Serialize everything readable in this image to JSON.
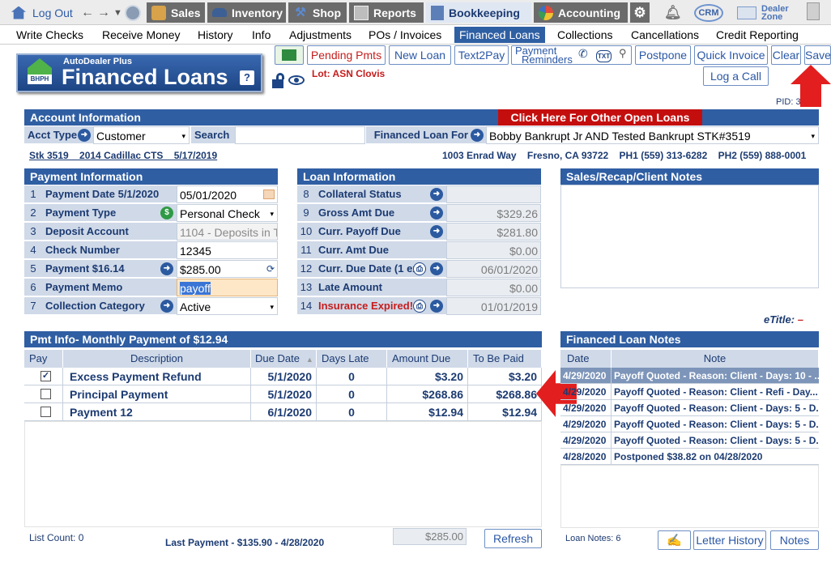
{
  "topnav": {
    "logout": "Log Out",
    "sales": "Sales",
    "inventory": "Inventory",
    "shop": "Shop",
    "reports": "Reports",
    "bookkeeping": "Bookkeeping",
    "accounting": "Accounting",
    "crm": "CRM",
    "dealer_zone_1": "Dealer",
    "dealer_zone_2": "Zone"
  },
  "subnav": [
    "Write Checks",
    "Receive Money",
    "History",
    "Info",
    "Adjustments",
    "POs / Invoices",
    "Financed Loans",
    "Collections",
    "Cancellations",
    "Credit Reporting"
  ],
  "header": {
    "brand_small": "AutoDealer Plus",
    "title": "Financed Loans",
    "bhph": "BHPH",
    "lot": "Lot: ASN Clovis",
    "pid": "PID: 3"
  },
  "toolbar": {
    "pending": "Pending Pmts",
    "new_loan": "New Loan",
    "text2pay": "Text2Pay",
    "reminders_1": "Payment",
    "reminders_2": "Reminders",
    "txt": "TXT",
    "postpone": "Postpone",
    "quick_invoice": "Quick Invoice",
    "clear": "Clear",
    "save": "Save",
    "log_call": "Log a Call"
  },
  "account": {
    "title": "Account Information",
    "other_loans": "Click Here For Other Open Loans",
    "acct_type_label": "Acct Type",
    "acct_type": "Customer",
    "search_label": "Search",
    "financed_for_label": "Financed Loan For",
    "financed_for": "Bobby Bankrupt Jr AND Tested Bankrupt STK#3519",
    "stk": "Stk 3519    2014 Cadillac CTS    5/17/2019",
    "address": "1003 Enrad Way    Fresno, CA 93722    PH1 (559) 313-6282    PH2 (559) 888-0001"
  },
  "payment": {
    "title": "Payment Information",
    "rows": [
      {
        "n": "1",
        "label": "Payment Date  5/1/2020",
        "value": "05/01/2020"
      },
      {
        "n": "2",
        "label": "Payment Type",
        "value": "Personal Check"
      },
      {
        "n": "3",
        "label": "Deposit Account",
        "value": "1104 - Deposits in T"
      },
      {
        "n": "4",
        "label": "Check Number",
        "value": "12345"
      },
      {
        "n": "5",
        "label": "Payment  $16.14",
        "value": "$285.00"
      },
      {
        "n": "6",
        "label": "Payment Memo",
        "value": "payoff"
      },
      {
        "n": "7",
        "label": "Collection Category",
        "value": "Active"
      }
    ]
  },
  "loan": {
    "title": "Loan Information",
    "rows": [
      {
        "n": "8",
        "label": "Collateral Status",
        "value": ""
      },
      {
        "n": "9",
        "label": "Gross Amt Due",
        "value": "$329.26"
      },
      {
        "n": "10",
        "label": "Curr. Payoff Due",
        "value": "$281.80"
      },
      {
        "n": "11",
        "label": "Curr. Amt Due",
        "value": "$0.00"
      },
      {
        "n": "12",
        "label": "Curr. Due Date (1 ex",
        "value": "06/01/2020"
      },
      {
        "n": "13",
        "label": "Late Amount",
        "value": "$0.00"
      },
      {
        "n": "14",
        "label": "Insurance Expired!",
        "value": "01/01/2019"
      }
    ]
  },
  "notes_panel": {
    "title": "Sales/Recap/Client Notes",
    "etitle": "eTitle:",
    "etitle_val": "–"
  },
  "pmt": {
    "title": "Pmt Info- Monthly Payment of $12.94",
    "headers": [
      "Pay",
      "Description",
      "Due Date",
      "Days Late",
      "Amount Due",
      "To Be Paid"
    ],
    "rows": [
      {
        "checked": "✓",
        "desc": "Excess Payment Refund",
        "due": "5/1/2020",
        "late": "0",
        "amt": "$3.20",
        "paid": "$3.20"
      },
      {
        "checked": "",
        "desc": "Principal Payment",
        "due": "5/1/2020",
        "late": "0",
        "amt": "$268.86",
        "paid": "$268.86"
      },
      {
        "checked": "",
        "desc": "Payment 12",
        "due": "6/1/2020",
        "late": "0",
        "amt": "$12.94",
        "paid": "$12.94"
      }
    ],
    "list_count": "List Count:  0",
    "last_payment": "Last Payment - $135.90 - 4/28/2020",
    "total": "$285.00",
    "refresh": "Refresh"
  },
  "loan_notes": {
    "title": "Financed Loan Notes",
    "headers": [
      "Date",
      "Note"
    ],
    "rows": [
      {
        "date": "4/29/2020",
        "note": "Payoff Quoted - Reason: Client - Days: 10 - ..."
      },
      {
        "date": "4/29/2020",
        "note": "Payoff Quoted - Reason: Client - Refi - Day..."
      },
      {
        "date": "4/29/2020",
        "note": "Payoff Quoted - Reason: Client - Days: 5 - D..."
      },
      {
        "date": "4/29/2020",
        "note": "Payoff Quoted - Reason: Client - Days: 5 - D..."
      },
      {
        "date": "4/29/2020",
        "note": "Payoff Quoted - Reason: Client - Days: 5 - D..."
      },
      {
        "date": "4/28/2020",
        "note": "Postponed $38.82 on 04/28/2020"
      }
    ],
    "count": "Loan Notes:  6",
    "letter_history": "Letter History",
    "notes": "Notes"
  }
}
